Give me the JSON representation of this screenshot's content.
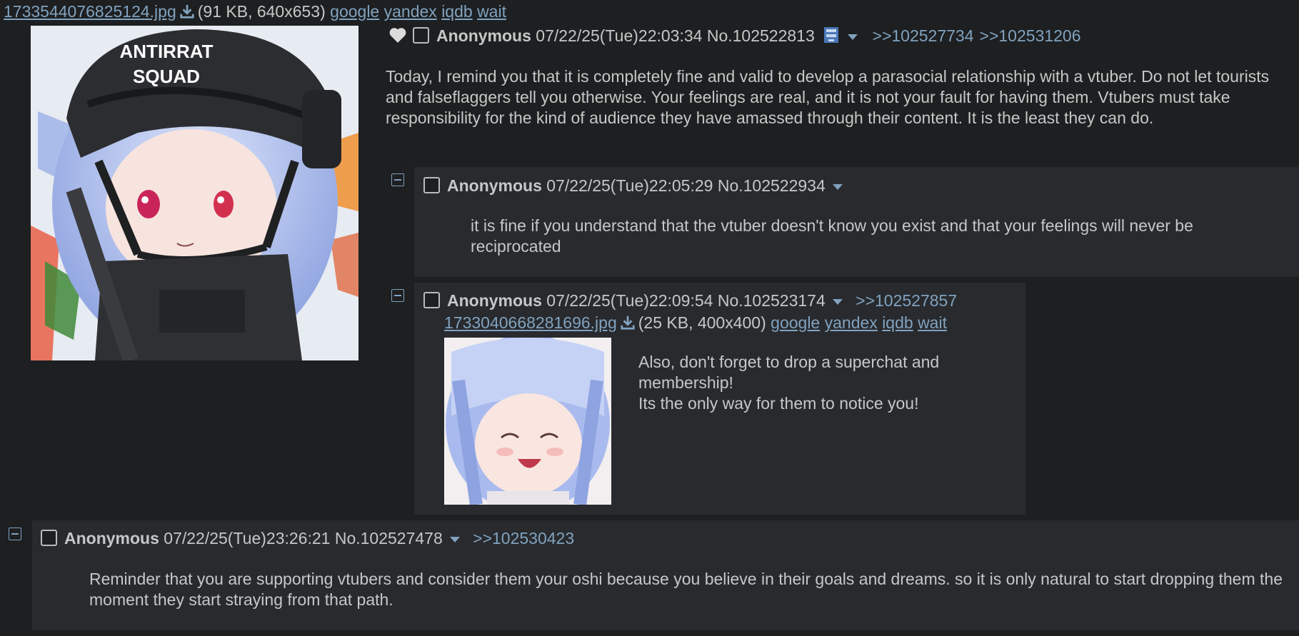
{
  "op": {
    "file_name": "1733544076825124.jpg",
    "file_info": "(91 KB, 640x653)",
    "search_links": [
      "google",
      "yandex",
      "iqdb",
      "wait"
    ],
    "image_caption": [
      "ANTIRRAT",
      "SQUAD"
    ],
    "name": "Anonymous",
    "datetime": "07/22/25(Tue)22:03:34",
    "post_no": "No.102522813",
    "backlinks": [
      ">>102527734",
      ">>102531206"
    ],
    "message": "Today, I remind you that it is completely fine and valid to develop a parasocial relationship with a vtuber. Do not let tourists and falseflaggers tell you otherwise. Your feelings are real, and it is not your fault for having them. Vtubers must take responsibility for the kind of audience they have amassed through their content. It is the least they can do."
  },
  "replies": [
    {
      "name": "Anonymous",
      "datetime": "07/22/25(Tue)22:05:29",
      "post_no": "No.102522934",
      "message": "it is fine if you understand that the vtuber doesn't know you exist and that your feelings will never be reciprocated"
    },
    {
      "name": "Anonymous",
      "datetime": "07/22/25(Tue)22:09:54",
      "post_no": "No.102523174",
      "backlinks": [
        ">>102527857"
      ],
      "file_name": "1733040668281696.jpg",
      "file_info": "(25 KB, 400x400)",
      "search_links": [
        "google",
        "yandex",
        "iqdb",
        "wait"
      ],
      "message_lines": [
        "Also, don't forget to drop a superchat and membership!",
        "Its the only way for them to notice you!"
      ]
    },
    {
      "name": "Anonymous",
      "datetime": "07/22/25(Tue)23:26:21",
      "post_no": "No.102527478",
      "backlinks": [
        ">>102530423"
      ],
      "message": "Reminder that you are supporting vtubers and consider them your oshi because you believe in their goals and dreams. so it is only natural to start dropping them the moment they start straying from that path."
    }
  ],
  "colors": {
    "background": "#1d1f21",
    "reply_background": "#282a2e",
    "text": "#c5c8c6",
    "link": "#81a2be"
  },
  "icons": [
    "heart-icon",
    "download-icon",
    "archive-icon",
    "menu-arrow-icon",
    "collapse-icon"
  ]
}
